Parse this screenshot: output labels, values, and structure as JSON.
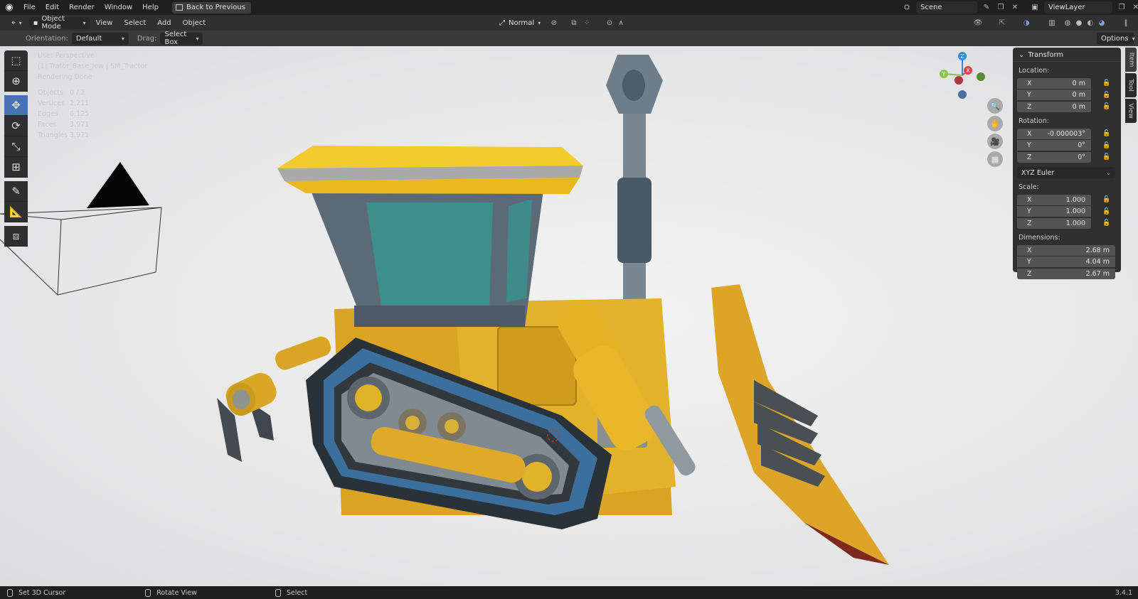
{
  "topbar": {
    "menus": [
      "File",
      "Edit",
      "Render",
      "Window",
      "Help"
    ],
    "back_button": "Back to Previous",
    "scene": "Scene",
    "view_layer": "ViewLayer"
  },
  "header": {
    "mode": "Object Mode",
    "menus": [
      "View",
      "Select",
      "Add",
      "Object"
    ],
    "transform_orientation": "Normal"
  },
  "tool_settings": {
    "orientation_label": "Orientation:",
    "orientation_value": "Default",
    "drag_label": "Drag:",
    "drag_value": "Select Box",
    "options": "Options"
  },
  "viewport": {
    "info_lines": [
      "User Perspective",
      "(1) Trator_Base_low | SM_Tractor",
      "Rendering Done"
    ],
    "stats": [
      {
        "key": "Objects",
        "value": "0 / 2"
      },
      {
        "key": "Vertices",
        "value": "2,211"
      },
      {
        "key": "Edges",
        "value": "6,125"
      },
      {
        "key": "Faces",
        "value": "3,971"
      },
      {
        "key": "Triangles",
        "value": "3,971"
      }
    ],
    "gizmo_axes": {
      "z": "Z",
      "y": "Y",
      "x": "X"
    }
  },
  "npanel": {
    "title": "Transform",
    "location_label": "Location:",
    "location": [
      {
        "axis": "X",
        "value": "0 m"
      },
      {
        "axis": "Y",
        "value": "0 m"
      },
      {
        "axis": "Z",
        "value": "0 m"
      }
    ],
    "rotation_label": "Rotation:",
    "rotation": [
      {
        "axis": "X",
        "value": "-0.000003°"
      },
      {
        "axis": "Y",
        "value": "0°"
      },
      {
        "axis": "Z",
        "value": "0°"
      }
    ],
    "rotation_mode": "XYZ Euler",
    "scale_label": "Scale:",
    "scale": [
      {
        "axis": "X",
        "value": "1.000"
      },
      {
        "axis": "Y",
        "value": "1.000"
      },
      {
        "axis": "Z",
        "value": "1.000"
      }
    ],
    "dimensions_label": "Dimensions:",
    "dimensions": [
      {
        "axis": "X",
        "value": "2.68 m"
      },
      {
        "axis": "Y",
        "value": "4.04 m"
      },
      {
        "axis": "Z",
        "value": "2.67 m"
      }
    ],
    "tabs": [
      "Item",
      "Tool",
      "View"
    ]
  },
  "statusbar": {
    "items": [
      "Set 3D Cursor",
      "Rotate View",
      "Select"
    ],
    "version": "3.4.1"
  },
  "colors": {
    "accent": "#4772b3",
    "axis_x": "#e0434f",
    "axis_y": "#8bc34a",
    "axis_z": "#2d8ceb"
  }
}
